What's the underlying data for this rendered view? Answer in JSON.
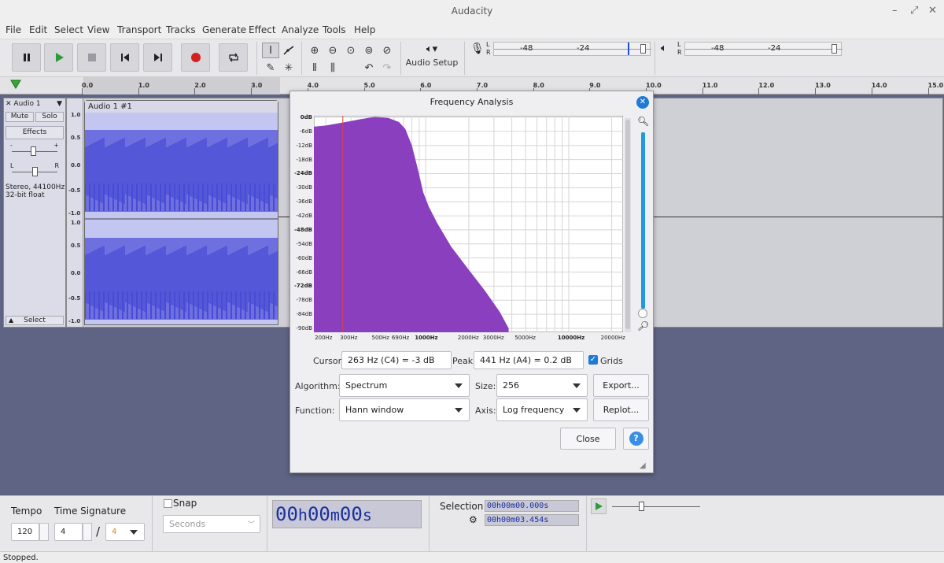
{
  "window": {
    "title": "Audacity"
  },
  "menu": [
    "File",
    "Edit",
    "Select",
    "View",
    "Transport",
    "Tracks",
    "Generate",
    "Effect",
    "Analyze",
    "Tools",
    "Help"
  ],
  "toolbar": {
    "audio_setup_label": "Audio Setup",
    "meter_ticks": [
      "-48",
      "-24"
    ],
    "rec_channels": [
      "L",
      "R"
    ],
    "play_channels": [
      "L",
      "R"
    ]
  },
  "ruler": {
    "ticks": [
      "0.0",
      "1.0",
      "2.0",
      "3.0",
      "4.0",
      "5.0",
      "6.0",
      "7.0",
      "8.0",
      "9.0",
      "10.0",
      "11.0",
      "12.0",
      "13.0",
      "14.0",
      "15.0"
    ]
  },
  "track": {
    "name": "Audio 1",
    "mute_label": "Mute",
    "solo_label": "Solo",
    "effects_label": "Effects",
    "gain_ends": [
      "-",
      "+"
    ],
    "pan_ends": [
      "L",
      "R"
    ],
    "info": "Stereo, 44100Hz",
    "format": "32-bit float",
    "select_label": "Select",
    "clip_name": "Audio 1 #1",
    "scale": [
      "1.0",
      "0.5",
      "0.0",
      "-0.5",
      "-1.0"
    ]
  },
  "dialog": {
    "title": "Frequency Analysis",
    "db_labels": [
      "0dB",
      "-6dB",
      "-12dB",
      "-18dB",
      "-24dB",
      "-30dB",
      "-36dB",
      "-42dB",
      "-48dB",
      "-54dB",
      "-60dB",
      "-66dB",
      "-72dB",
      "-78dB",
      "-84dB",
      "-90dB"
    ],
    "hz_labels": [
      "200Hz",
      "300Hz",
      "500Hz",
      "690Hz",
      "1000Hz",
      "2000Hz",
      "3000Hz",
      "5000Hz",
      "10000Hz",
      "20000Hz"
    ],
    "cursor_label": "Cursor:",
    "cursor_value": "263 Hz (C4) = -3 dB",
    "peak_label": "Peak:",
    "peak_value": "441 Hz (A4) = 0.2 dB",
    "grids_label": "Grids",
    "grids_checked": true,
    "algorithm_label": "Algorithm:",
    "algorithm_value": "Spectrum",
    "size_label": "Size:",
    "size_value": "256",
    "function_label": "Function:",
    "function_value": "Hann window",
    "axis_label": "Axis:",
    "axis_value": "Log frequency",
    "export_label": "Export...",
    "replot_label": "Replot...",
    "close_label": "Close",
    "help_label": "?",
    "spectrum_color": "#8a3fbf"
  },
  "bottom": {
    "tempo_label": "Tempo",
    "tempo_value": "120",
    "time_sig_label": "Time Signature",
    "time_sig_num": "4",
    "time_sig_slash": "/",
    "time_sig_den": "4",
    "snap_label": "Snap",
    "snap_unit": "Seconds",
    "time_h": "00",
    "time_h_unit": "h",
    "time_m": "00",
    "time_m_unit": "m",
    "time_s": "00",
    "time_s_unit": "s",
    "selection_label": "Selection",
    "sel_start": "00h00m00.000s",
    "sel_end": "00h00m03.454s"
  },
  "status": {
    "text": "Stopped."
  },
  "colors": {
    "wave": "#3b3fd1",
    "wave_bg": "#6e70e0",
    "accent": "#1f7ad6"
  }
}
